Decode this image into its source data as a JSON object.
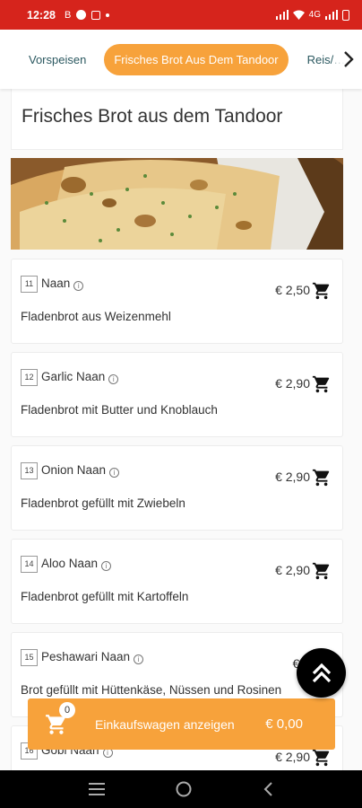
{
  "status": {
    "time": "12:28",
    "left_icons": [
      "b-icon",
      "record-icon",
      "mail-icon"
    ],
    "right_text": "4G"
  },
  "tabs": [
    {
      "label": "Vorspeisen",
      "active": false
    },
    {
      "label": "Frisches Brot Aus Dem Tandoor",
      "active": true
    },
    {
      "label": "Reis/…",
      "active": false
    }
  ],
  "section": {
    "title": "Frisches Brot aus dem Tandoor"
  },
  "items": [
    {
      "num": "11",
      "name": "Naan",
      "price": "€ 2,50",
      "desc": "Fladenbrot aus Weizenmehl"
    },
    {
      "num": "12",
      "name": "Garlic Naan",
      "price": "€ 2,90",
      "desc": "Fladenbrot mit Butter und Knoblauch"
    },
    {
      "num": "13",
      "name": "Onion Naan",
      "price": "€ 2,90",
      "desc": "Fladenbrot gefüllt mit Zwiebeln"
    },
    {
      "num": "14",
      "name": "Aloo Naan",
      "price": "€ 2,90",
      "desc": "Fladenbrot gefüllt mit Kartoffeln"
    },
    {
      "num": "15",
      "name": "Peshawari Naan",
      "price": "€ 3",
      "desc": "Brot gefüllt mit Hüttenkäse, Nüssen und Rosinen"
    },
    {
      "num": "16",
      "name": "Gobi Naan",
      "price": "€ 2,90",
      "desc": ""
    }
  ],
  "cart": {
    "count": "0",
    "label": "Einkaufswagen anzeigen",
    "total": "€ 0,00"
  },
  "colors": {
    "accent": "#f7a23b",
    "statusbar": "#d6241c",
    "tab_text": "#2c5961"
  }
}
